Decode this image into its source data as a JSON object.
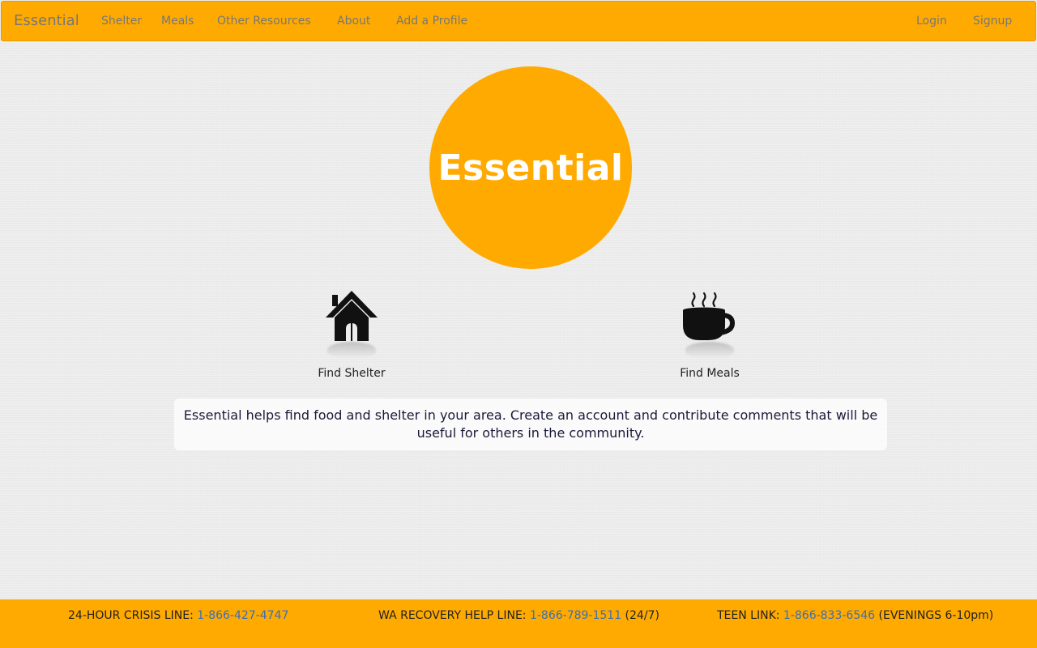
{
  "navbar": {
    "brand": "Essential",
    "links": [
      "Shelter",
      "Meals",
      "Other Resources",
      "About",
      "Add a Profile"
    ],
    "login": "Login",
    "signup": "Signup"
  },
  "hero": {
    "title": "Essential"
  },
  "actions": {
    "shelter": {
      "label": "Find Shelter",
      "icon": "house-icon"
    },
    "meals": {
      "label": "Find Meals",
      "icon": "coffee-cup-icon"
    }
  },
  "description": "Essential helps find food and shelter in your area. Create an account and contribute comments that will be useful for others in the community.",
  "footer": {
    "crisis": {
      "label": "24-HOUR CRISIS LINE: ",
      "phone": "1-866-427-4747",
      "suffix": ""
    },
    "recovery": {
      "label": "WA RECOVERY HELP LINE: ",
      "phone": "1-866-789-1511",
      "suffix": " (24/7)"
    },
    "teen": {
      "label": "TEEN LINK: ",
      "phone": "1-866-833-6546",
      "suffix": " (EVENINGS 6-10pm)"
    }
  },
  "colors": {
    "accent": "#ffaa00",
    "nav_text": "#777777",
    "link": "#3b6fb5"
  }
}
